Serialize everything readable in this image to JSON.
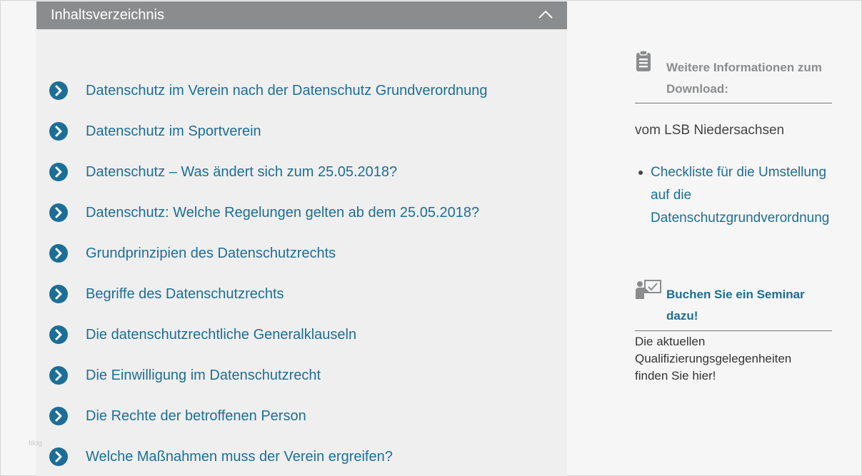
{
  "toc": {
    "title": "Inhaltsverzeichnis",
    "toggle_icon": "chevron-up-icon",
    "item_icon": "chevron-right-circle-icon",
    "accent_color": "#1d6e96",
    "header_color": "#8a8c8e",
    "items": [
      {
        "label": "Datenschutz im Verein nach der Datenschutz Grundverordnung"
      },
      {
        "label": "Datenschutz im Sportverein"
      },
      {
        "label": "Datenschutz – Was ändert sich zum 25.05.2018?"
      },
      {
        "label": "Datenschutz: Welche Regelungen gelten ab dem 25.05.2018?"
      },
      {
        "label": "Grundprinzipien des Datenschutzrechts"
      },
      {
        "label": "Begriffe des Datenschutzrechts"
      },
      {
        "label": "Die datenschutzrechtliche Generalklauseln"
      },
      {
        "label": "Die Einwilligung im Datenschutzrecht"
      },
      {
        "label": "Die Rechte der betroffenen Person"
      },
      {
        "label": "Welche Maßnahmen muss der Verein ergreifen?"
      }
    ]
  },
  "sidebar": {
    "download": {
      "icon": "clipboard-icon",
      "heading_line1": "Weitere Informationen zum",
      "heading_line2": "Download:",
      "source": "vom LSB Niedersachsen",
      "link_label": "Checkliste für die Umstellung auf die Datenschutzgrundverordnung"
    },
    "seminar": {
      "icon": "presentation-icon",
      "heading_line1": "Buchen Sie ein Seminar",
      "heading_line2": "dazu!",
      "text": "Die aktuellen Qualifizierungsgelegenheiten finden Sie hier!"
    }
  },
  "watermark": "blog"
}
